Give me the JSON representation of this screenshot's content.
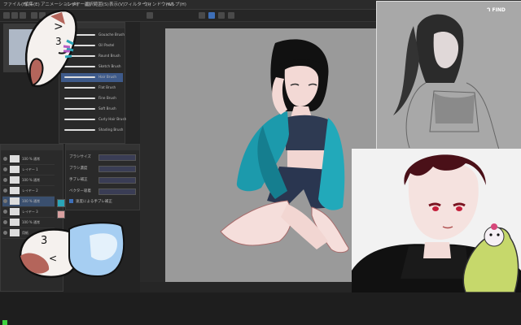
{
  "menu": {
    "items": [
      "ファイル(F)",
      "編集(E)",
      "アニメーション(A)",
      "レイヤー(L)",
      "選択範囲(S)",
      "表示(V)",
      "フィルター(I)",
      "ウィンドウ(W)",
      "ヘルプ(H)"
    ]
  },
  "brushes": {
    "items": [
      "Gouache Brush",
      "Oil Pastel",
      "Round Brush",
      "Sketch Brush",
      "Hair Brush",
      "Flat Brush",
      "Fine Brush",
      "Soft Brush",
      "Curly Hair Brush",
      "Shading Brush"
    ]
  },
  "tool_property": {
    "opacity_label": "ブラシサイズ",
    "fields": [
      "ブラシ濃度",
      "手ブレ補正",
      "ベクター吸着"
    ],
    "checkbox_label": "速度による手ブレ補正"
  },
  "layers": {
    "items": [
      "100 % 通常",
      "レイヤー 1",
      "100 % 通常",
      "レイヤー 2",
      "100 % 通常",
      "レイヤー 3",
      "100 % 通常",
      "用紙"
    ]
  },
  "colors": {
    "accent": "#2aa5b8",
    "layer_active": "#4a7ccf",
    "green_toggle": "#3fd13f",
    "canvas": "#9a9a9a"
  },
  "icons": [
    "pen-icon",
    "eraser-icon",
    "fill-icon",
    "move-icon",
    "eye-icon"
  ],
  "ref_tag": "ᒉ FIND"
}
